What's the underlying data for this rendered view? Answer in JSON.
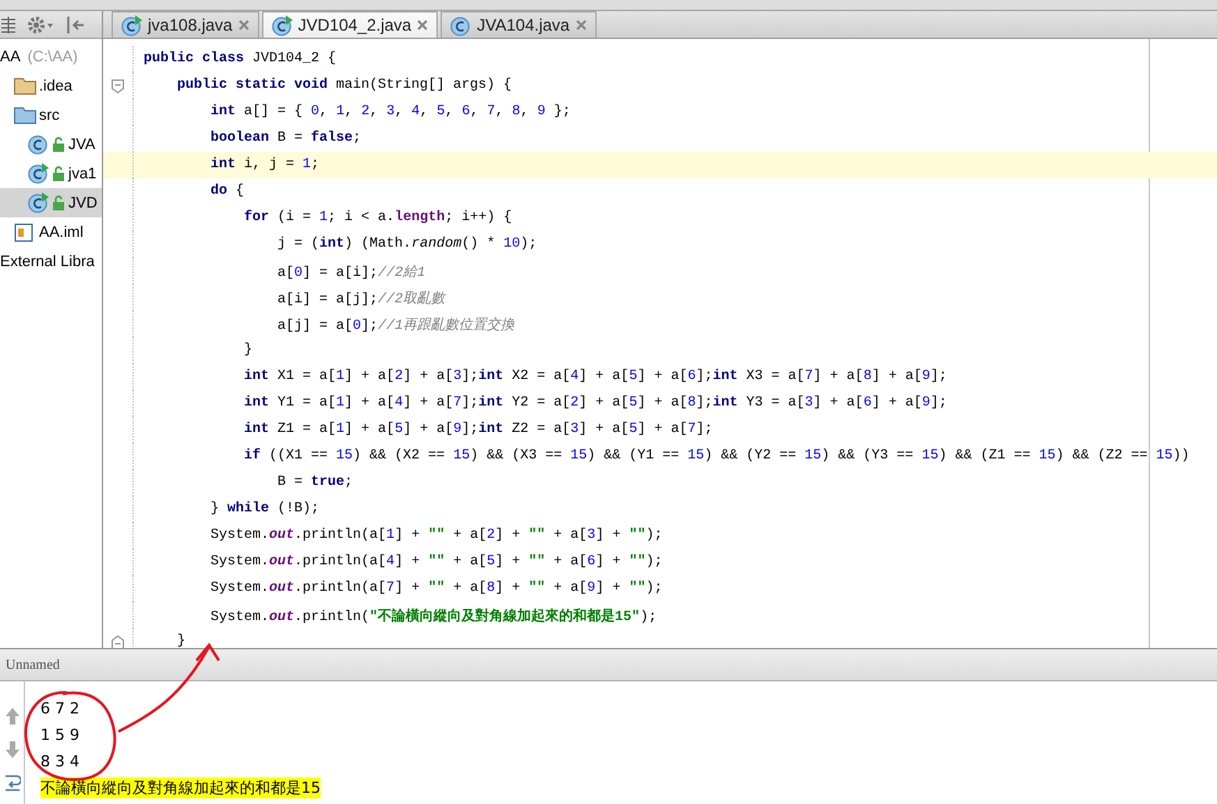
{
  "sidebar": {
    "tree": [
      {
        "label": "AA",
        "hint": "(C:\\AA)",
        "selected": false,
        "children": [
          {
            "label": ".idea",
            "kind": "folder",
            "selected": false
          },
          {
            "label": "src",
            "kind": "source-folder",
            "selected": false,
            "children": [
              {
                "label": "JVA",
                "kind": "class",
                "runnable": false,
                "selected": false
              },
              {
                "label": "jva1",
                "kind": "class",
                "runnable": true,
                "selected": false
              },
              {
                "label": "JVD",
                "kind": "class",
                "runnable": true,
                "selected": true
              }
            ]
          },
          {
            "label": "AA.iml",
            "kind": "module",
            "selected": false
          }
        ]
      },
      {
        "label": "External Libra",
        "selected": false
      }
    ]
  },
  "tabs": [
    {
      "label": "jva108.java",
      "runnable": true,
      "selected": false
    },
    {
      "label": "JVD104_2.java",
      "runnable": true,
      "selected": true
    },
    {
      "label": "JVA104.java",
      "runnable": false,
      "selected": false
    }
  ],
  "editor": {
    "lines": [
      {
        "segments": [
          {
            "kind": "kw",
            "text": "public class"
          },
          {
            "kind": "plain",
            "text": " JVD104_2 {"
          }
        ]
      },
      {
        "fold_start": true,
        "segments": [
          {
            "kind": "kw",
            "text": "    public static void"
          },
          {
            "kind": "plain",
            "text": " main(String[] args) {"
          }
        ]
      },
      {
        "segments": [
          {
            "kind": "kw",
            "text": "        int"
          },
          {
            "kind": "plain",
            "text": " a[] = { "
          },
          {
            "kind": "num",
            "text": "0"
          },
          {
            "kind": "plain",
            "text": ", "
          },
          {
            "kind": "num",
            "text": "1"
          },
          {
            "kind": "plain",
            "text": ", "
          },
          {
            "kind": "num",
            "text": "2"
          },
          {
            "kind": "plain",
            "text": ", "
          },
          {
            "kind": "num",
            "text": "3"
          },
          {
            "kind": "plain",
            "text": ", "
          },
          {
            "kind": "num",
            "text": "4"
          },
          {
            "kind": "plain",
            "text": ", "
          },
          {
            "kind": "num",
            "text": "5"
          },
          {
            "kind": "plain",
            "text": ", "
          },
          {
            "kind": "num",
            "text": "6"
          },
          {
            "kind": "plain",
            "text": ", "
          },
          {
            "kind": "num",
            "text": "7"
          },
          {
            "kind": "plain",
            "text": ", "
          },
          {
            "kind": "num",
            "text": "8"
          },
          {
            "kind": "plain",
            "text": ", "
          },
          {
            "kind": "num",
            "text": "9"
          },
          {
            "kind": "plain",
            "text": " };"
          }
        ]
      },
      {
        "segments": [
          {
            "kind": "kw",
            "text": "        boolean"
          },
          {
            "kind": "plain",
            "text": " B = "
          },
          {
            "kind": "kw",
            "text": "false"
          },
          {
            "kind": "plain",
            "text": ";"
          }
        ]
      },
      {
        "current": true,
        "segments": [
          {
            "kind": "kw",
            "text": "        int"
          },
          {
            "kind": "plain",
            "text": " i, j = "
          },
          {
            "kind": "num",
            "text": "1"
          },
          {
            "kind": "plain",
            "text": ";"
          }
        ]
      },
      {
        "segments": [
          {
            "kind": "kw",
            "text": "        do"
          },
          {
            "kind": "plain",
            "text": " {"
          }
        ]
      },
      {
        "segments": [
          {
            "kind": "kw",
            "text": "            for"
          },
          {
            "kind": "plain",
            "text": " (i = "
          },
          {
            "kind": "num",
            "text": "1"
          },
          {
            "kind": "plain",
            "text": "; i < a."
          },
          {
            "kind": "prop",
            "text": "length"
          },
          {
            "kind": "plain",
            "text": "; i++) {"
          }
        ]
      },
      {
        "segments": [
          {
            "kind": "plain",
            "text": "                j = ("
          },
          {
            "kind": "kw",
            "text": "int"
          },
          {
            "kind": "plain",
            "text": ") (Math."
          },
          {
            "kind": "method",
            "text": "random"
          },
          {
            "kind": "plain",
            "text": "() * "
          },
          {
            "kind": "num",
            "text": "10"
          },
          {
            "kind": "plain",
            "text": ");"
          }
        ]
      },
      {
        "segments": [
          {
            "kind": "plain",
            "text": "                a["
          },
          {
            "kind": "num",
            "text": "0"
          },
          {
            "kind": "plain",
            "text": "] = a[i];"
          },
          {
            "kind": "comment",
            "text": "//2給1"
          }
        ]
      },
      {
        "segments": [
          {
            "kind": "plain",
            "text": "                a[i] = a[j];"
          },
          {
            "kind": "comment",
            "text": "//2取亂數"
          }
        ]
      },
      {
        "segments": [
          {
            "kind": "plain",
            "text": "                a[j] = a["
          },
          {
            "kind": "num",
            "text": "0"
          },
          {
            "kind": "plain",
            "text": "];"
          },
          {
            "kind": "comment",
            "text": "//1再跟亂數位置交換"
          }
        ]
      },
      {
        "segments": [
          {
            "kind": "plain",
            "text": "            }"
          }
        ]
      },
      {
        "segments": [
          {
            "kind": "kw",
            "text": "            int"
          },
          {
            "kind": "plain",
            "text": " X1 = a["
          },
          {
            "kind": "num",
            "text": "1"
          },
          {
            "kind": "plain",
            "text": "] + a["
          },
          {
            "kind": "num",
            "text": "2"
          },
          {
            "kind": "plain",
            "text": "] + a["
          },
          {
            "kind": "num",
            "text": "3"
          },
          {
            "kind": "plain",
            "text": "];"
          },
          {
            "kind": "kw",
            "text": "int"
          },
          {
            "kind": "plain",
            "text": " X2 = a["
          },
          {
            "kind": "num",
            "text": "4"
          },
          {
            "kind": "plain",
            "text": "] + a["
          },
          {
            "kind": "num",
            "text": "5"
          },
          {
            "kind": "plain",
            "text": "] + a["
          },
          {
            "kind": "num",
            "text": "6"
          },
          {
            "kind": "plain",
            "text": "];"
          },
          {
            "kind": "kw",
            "text": "int"
          },
          {
            "kind": "plain",
            "text": " X3 = a["
          },
          {
            "kind": "num",
            "text": "7"
          },
          {
            "kind": "plain",
            "text": "] + a["
          },
          {
            "kind": "num",
            "text": "8"
          },
          {
            "kind": "plain",
            "text": "] + a["
          },
          {
            "kind": "num",
            "text": "9"
          },
          {
            "kind": "plain",
            "text": "];"
          }
        ]
      },
      {
        "segments": [
          {
            "kind": "kw",
            "text": "            int"
          },
          {
            "kind": "plain",
            "text": " Y1 = a["
          },
          {
            "kind": "num",
            "text": "1"
          },
          {
            "kind": "plain",
            "text": "] + a["
          },
          {
            "kind": "num",
            "text": "4"
          },
          {
            "kind": "plain",
            "text": "] + a["
          },
          {
            "kind": "num",
            "text": "7"
          },
          {
            "kind": "plain",
            "text": "];"
          },
          {
            "kind": "kw",
            "text": "int"
          },
          {
            "kind": "plain",
            "text": " Y2 = a["
          },
          {
            "kind": "num",
            "text": "2"
          },
          {
            "kind": "plain",
            "text": "] + a["
          },
          {
            "kind": "num",
            "text": "5"
          },
          {
            "kind": "plain",
            "text": "] + a["
          },
          {
            "kind": "num",
            "text": "8"
          },
          {
            "kind": "plain",
            "text": "];"
          },
          {
            "kind": "kw",
            "text": "int"
          },
          {
            "kind": "plain",
            "text": " Y3 = a["
          },
          {
            "kind": "num",
            "text": "3"
          },
          {
            "kind": "plain",
            "text": "] + a["
          },
          {
            "kind": "num",
            "text": "6"
          },
          {
            "kind": "plain",
            "text": "] + a["
          },
          {
            "kind": "num",
            "text": "9"
          },
          {
            "kind": "plain",
            "text": "];"
          }
        ]
      },
      {
        "segments": [
          {
            "kind": "kw",
            "text": "            int"
          },
          {
            "kind": "plain",
            "text": " Z1 = a["
          },
          {
            "kind": "num",
            "text": "1"
          },
          {
            "kind": "plain",
            "text": "] + a["
          },
          {
            "kind": "num",
            "text": "5"
          },
          {
            "kind": "plain",
            "text": "] + a["
          },
          {
            "kind": "num",
            "text": "9"
          },
          {
            "kind": "plain",
            "text": "];"
          },
          {
            "kind": "kw",
            "text": "int"
          },
          {
            "kind": "plain",
            "text": " Z2 = a["
          },
          {
            "kind": "num",
            "text": "3"
          },
          {
            "kind": "plain",
            "text": "] + a["
          },
          {
            "kind": "num",
            "text": "5"
          },
          {
            "kind": "plain",
            "text": "] + a["
          },
          {
            "kind": "num",
            "text": "7"
          },
          {
            "kind": "plain",
            "text": "];"
          }
        ]
      },
      {
        "segments": [
          {
            "kind": "kw",
            "text": "            if"
          },
          {
            "kind": "plain",
            "text": " ((X1 == "
          },
          {
            "kind": "num",
            "text": "15"
          },
          {
            "kind": "plain",
            "text": ") && (X2 == "
          },
          {
            "kind": "num",
            "text": "15"
          },
          {
            "kind": "plain",
            "text": ") && (X3 == "
          },
          {
            "kind": "num",
            "text": "15"
          },
          {
            "kind": "plain",
            "text": ") && (Y1 == "
          },
          {
            "kind": "num",
            "text": "15"
          },
          {
            "kind": "plain",
            "text": ") && (Y2 == "
          },
          {
            "kind": "num",
            "text": "15"
          },
          {
            "kind": "plain",
            "text": ") && (Y3 == "
          },
          {
            "kind": "num",
            "text": "15"
          },
          {
            "kind": "plain",
            "text": ") && (Z1 == "
          },
          {
            "kind": "num",
            "text": "15"
          },
          {
            "kind": "plain",
            "text": ") && (Z2 == "
          },
          {
            "kind": "num",
            "text": "15"
          },
          {
            "kind": "plain",
            "text": "))"
          }
        ]
      },
      {
        "segments": [
          {
            "kind": "plain",
            "text": "                B = "
          },
          {
            "kind": "kw",
            "text": "true"
          },
          {
            "kind": "plain",
            "text": ";"
          }
        ]
      },
      {
        "segments": [
          {
            "kind": "plain",
            "text": "        } "
          },
          {
            "kind": "kw",
            "text": "while"
          },
          {
            "kind": "plain",
            "text": " (!B);"
          }
        ]
      },
      {
        "segments": [
          {
            "kind": "plain",
            "text": "        System."
          },
          {
            "kind": "field",
            "text": "out"
          },
          {
            "kind": "plain",
            "text": ".println(a["
          },
          {
            "kind": "num",
            "text": "1"
          },
          {
            "kind": "plain",
            "text": "] + "
          },
          {
            "kind": "str",
            "text": "\"\""
          },
          {
            "kind": "plain",
            "text": " + a["
          },
          {
            "kind": "num",
            "text": "2"
          },
          {
            "kind": "plain",
            "text": "] + "
          },
          {
            "kind": "str",
            "text": "\"\""
          },
          {
            "kind": "plain",
            "text": " + a["
          },
          {
            "kind": "num",
            "text": "3"
          },
          {
            "kind": "plain",
            "text": "] + "
          },
          {
            "kind": "str",
            "text": "\"\""
          },
          {
            "kind": "plain",
            "text": ");"
          }
        ]
      },
      {
        "segments": [
          {
            "kind": "plain",
            "text": "        System."
          },
          {
            "kind": "field",
            "text": "out"
          },
          {
            "kind": "plain",
            "text": ".println(a["
          },
          {
            "kind": "num",
            "text": "4"
          },
          {
            "kind": "plain",
            "text": "] + "
          },
          {
            "kind": "str",
            "text": "\"\""
          },
          {
            "kind": "plain",
            "text": " + a["
          },
          {
            "kind": "num",
            "text": "5"
          },
          {
            "kind": "plain",
            "text": "] + "
          },
          {
            "kind": "str",
            "text": "\"\""
          },
          {
            "kind": "plain",
            "text": " + a["
          },
          {
            "kind": "num",
            "text": "6"
          },
          {
            "kind": "plain",
            "text": "] + "
          },
          {
            "kind": "str",
            "text": "\"\""
          },
          {
            "kind": "plain",
            "text": ");"
          }
        ]
      },
      {
        "segments": [
          {
            "kind": "plain",
            "text": "        System."
          },
          {
            "kind": "field",
            "text": "out"
          },
          {
            "kind": "plain",
            "text": ".println(a["
          },
          {
            "kind": "num",
            "text": "7"
          },
          {
            "kind": "plain",
            "text": "] + "
          },
          {
            "kind": "str",
            "text": "\"\""
          },
          {
            "kind": "plain",
            "text": " + a["
          },
          {
            "kind": "num",
            "text": "8"
          },
          {
            "kind": "plain",
            "text": "] + "
          },
          {
            "kind": "str",
            "text": "\"\""
          },
          {
            "kind": "plain",
            "text": " + a["
          },
          {
            "kind": "num",
            "text": "9"
          },
          {
            "kind": "plain",
            "text": "] + "
          },
          {
            "kind": "str",
            "text": "\"\""
          },
          {
            "kind": "plain",
            "text": ");"
          }
        ]
      },
      {
        "segments": [
          {
            "kind": "plain",
            "text": "        System."
          },
          {
            "kind": "field",
            "text": "out"
          },
          {
            "kind": "plain",
            "text": ".println("
          },
          {
            "kind": "str",
            "text": "\"不論橫向縱向及對角線加起來的和都是15\""
          },
          {
            "kind": "plain",
            "text": ");"
          }
        ]
      },
      {
        "fold_end": true,
        "segments": [
          {
            "kind": "plain",
            "text": "    }"
          }
        ]
      }
    ]
  },
  "run_panel": {
    "title": "Unnamed",
    "output": [
      {
        "text": "6 7 2",
        "highlighted": false
      },
      {
        "text": "1 5 9",
        "highlighted": false
      },
      {
        "text": "8 3 4",
        "highlighted": false
      },
      {
        "text": "不論橫向縱向及對角線加起來的和都是15",
        "highlighted": true
      }
    ]
  }
}
